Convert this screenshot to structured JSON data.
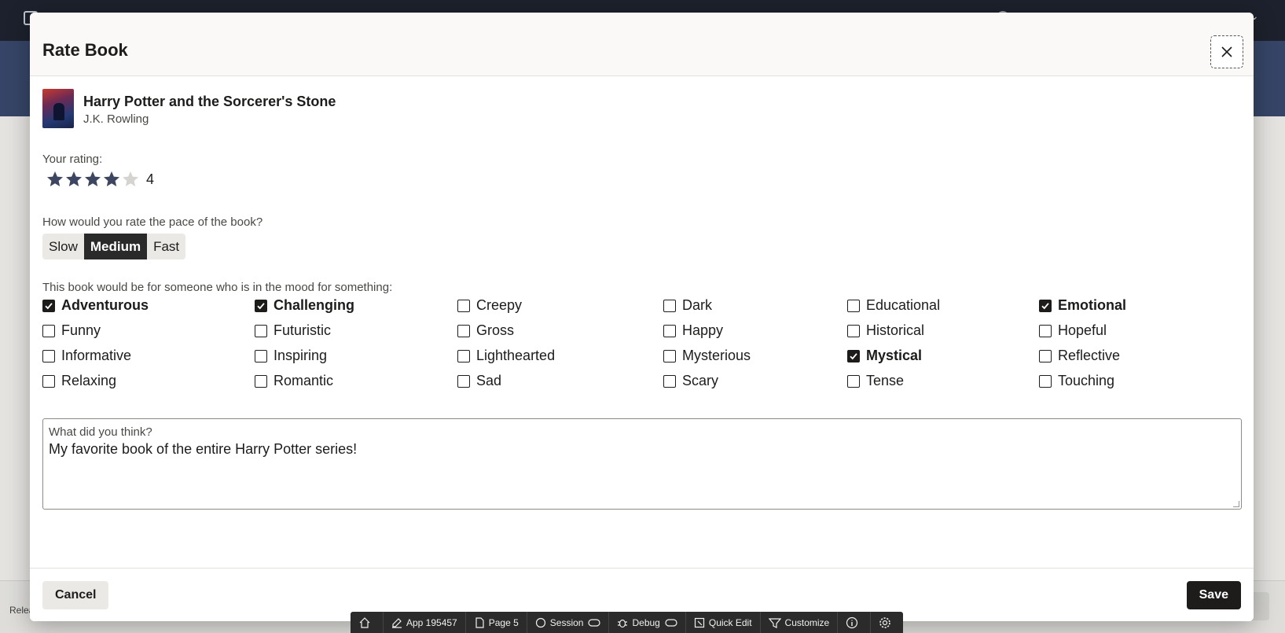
{
  "dialog": {
    "title": "Rate Book"
  },
  "book": {
    "title": "Harry Potter and the Sorcerer's Stone",
    "author": "J.K. Rowling"
  },
  "rating": {
    "label": "Your rating:",
    "value": 4,
    "value_text": "4",
    "max": 5
  },
  "pace": {
    "label": "How would you rate the pace of the book?",
    "options": [
      "Slow",
      "Medium",
      "Fast"
    ],
    "selected": "Medium"
  },
  "moods": {
    "label": "This book would be for someone who is in the mood for something:",
    "items": [
      {
        "label": "Adventurous",
        "checked": true
      },
      {
        "label": "Challenging",
        "checked": true
      },
      {
        "label": "Creepy",
        "checked": false
      },
      {
        "label": "Dark",
        "checked": false
      },
      {
        "label": "Educational",
        "checked": false
      },
      {
        "label": "Emotional",
        "checked": true
      },
      {
        "label": "Funny",
        "checked": false
      },
      {
        "label": "Futuristic",
        "checked": false
      },
      {
        "label": "Gross",
        "checked": false
      },
      {
        "label": "Happy",
        "checked": false
      },
      {
        "label": "Historical",
        "checked": false
      },
      {
        "label": "Hopeful",
        "checked": false
      },
      {
        "label": "Informative",
        "checked": false
      },
      {
        "label": "Inspiring",
        "checked": false
      },
      {
        "label": "Lighthearted",
        "checked": false
      },
      {
        "label": "Mysterious",
        "checked": false
      },
      {
        "label": "Mystical",
        "checked": true
      },
      {
        "label": "Reflective",
        "checked": false
      },
      {
        "label": "Relaxing",
        "checked": false
      },
      {
        "label": "Romantic",
        "checked": false
      },
      {
        "label": "Sad",
        "checked": false
      },
      {
        "label": "Scary",
        "checked": false
      },
      {
        "label": "Tense",
        "checked": false
      },
      {
        "label": "Touching",
        "checked": false
      }
    ]
  },
  "review": {
    "label": "What did you think?",
    "value": "My favorite book of the entire Harry Potter series!"
  },
  "buttons": {
    "cancel": "Cancel",
    "save": "Save"
  },
  "background": {
    "footer_text": "Relea"
  },
  "dev_toolbar": {
    "app": "App 195457",
    "page": "Page 5",
    "session": "Session",
    "debug": "Debug",
    "quick_edit": "Quick Edit",
    "customize": "Customize"
  },
  "colors": {
    "star_filled": "#3d4660",
    "star_empty": "#d6d4d0",
    "selected_pace": "#2a2a2a"
  }
}
